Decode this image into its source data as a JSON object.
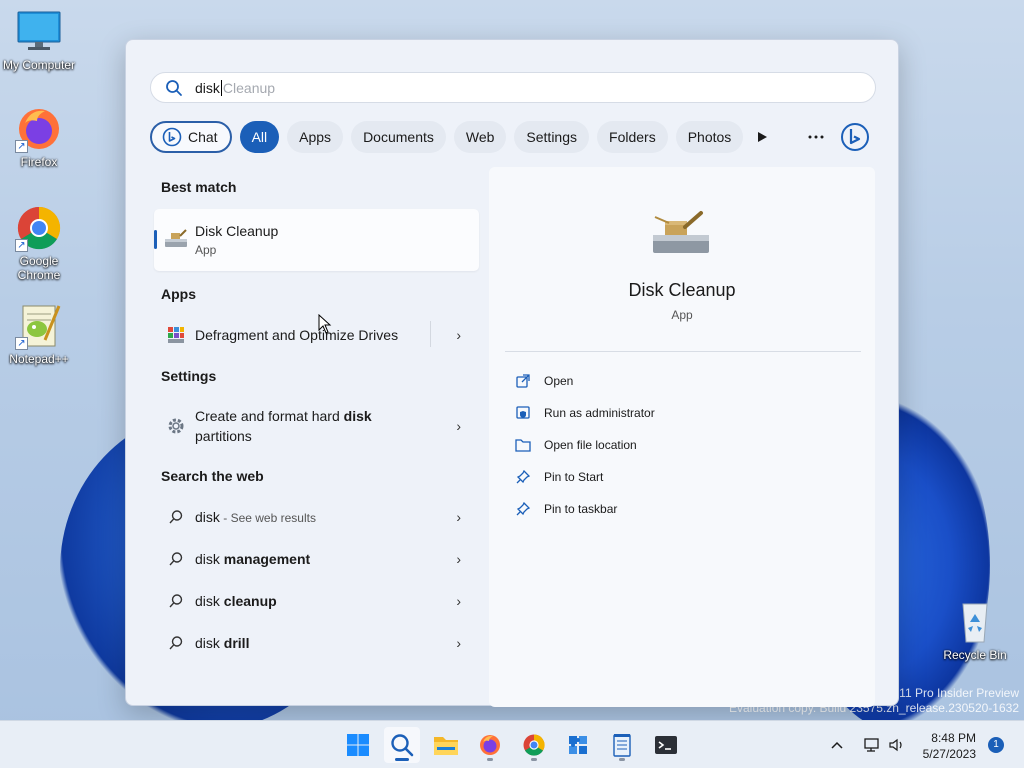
{
  "desktop": {
    "icons": [
      {
        "label": "My Computer",
        "icon": "computer-icon"
      },
      {
        "label": "Firefox",
        "icon": "firefox-icon"
      },
      {
        "label": "Google Chrome",
        "icon": "chrome-icon"
      },
      {
        "label": "Notepad++",
        "icon": "notepadpp-icon"
      },
      {
        "label": "Recycle Bin",
        "icon": "recycle-bin-icon"
      }
    ]
  },
  "search": {
    "typed": "disk",
    "suggestion": "Cleanup"
  },
  "filters": {
    "items": [
      "Chat",
      "All",
      "Apps",
      "Documents",
      "Web",
      "Settings",
      "Folders",
      "Photos"
    ],
    "active": "All"
  },
  "results": {
    "best_match_heading": "Best match",
    "best_match": {
      "name": "Disk Cleanup",
      "type": "App"
    },
    "apps_heading": "Apps",
    "apps": [
      {
        "label": "Defragment and Optimize Drives"
      }
    ],
    "settings_heading": "Settings",
    "settings": [
      {
        "label_pre": "Create and format hard ",
        "label_bold": "disk",
        "label_post": "partitions"
      }
    ],
    "web_heading": "Search the web",
    "web": [
      {
        "pre": "disk",
        "bold": "",
        "sub": " - See web results"
      },
      {
        "pre": "disk ",
        "bold": "management",
        "sub": ""
      },
      {
        "pre": "disk ",
        "bold": "cleanup",
        "sub": ""
      },
      {
        "pre": "disk ",
        "bold": "drill",
        "sub": ""
      }
    ]
  },
  "detail": {
    "name": "Disk Cleanup",
    "type": "App",
    "actions": [
      "Open",
      "Run as administrator",
      "Open file location",
      "Pin to Start",
      "Pin to taskbar"
    ]
  },
  "watermark": {
    "line1": "11 Pro Insider Preview",
    "line2": "Evaluation copy. Build 23575.zn_release.230520-1632"
  },
  "taskbar": {
    "time": "8:48 PM",
    "date": "5/27/2023",
    "notification_count": "1"
  },
  "colors": {
    "accent": "#1b5fb8",
    "panel_bg": "#eef2f9"
  }
}
